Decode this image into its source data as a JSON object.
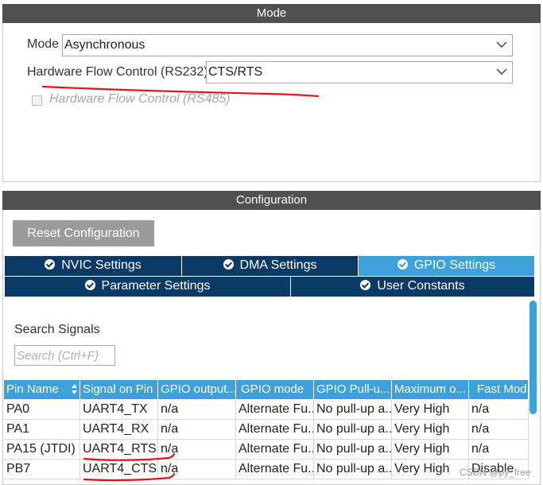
{
  "mode_section": {
    "header": "Mode",
    "mode_label": "Mode",
    "mode_value": "Asynchronous",
    "hw_flow_label": "Hardware Flow Control (RS232)",
    "hw_flow_value": "CTS/RTS",
    "rs485_label": "Hardware Flow Control (RS485)"
  },
  "config_section": {
    "header": "Configuration",
    "reset_button": "Reset Configuration",
    "tabs_row1": [
      "NVIC Settings",
      "DMA Settings",
      "GPIO Settings"
    ],
    "tabs_row2": [
      "Parameter Settings",
      "User Constants"
    ],
    "active_tab": "GPIO Settings",
    "search_label": "Search Signals",
    "search_placeholder": "Search (Ctrl+F)"
  },
  "table": {
    "columns": [
      "Pin Name",
      "Signal on Pin",
      "GPIO output...",
      "GPIO mode",
      "GPIO Pull-u...",
      "Maximum o...",
      "Fast Mod"
    ],
    "rows": [
      [
        "PA0",
        "UART4_TX",
        "n/a",
        "Alternate Fu...",
        "No pull-up a...",
        "Very High",
        "n/a"
      ],
      [
        "PA1",
        "UART4_RX",
        "n/a",
        "Alternate Fu...",
        "No pull-up a...",
        "Very High",
        "n/a"
      ],
      [
        "PA15 (JTDI)",
        "UART4_RTS",
        "n/a",
        "Alternate Fu...",
        "No pull-up a...",
        "Very High",
        "n/a"
      ],
      [
        "PB7",
        "UART4_CTS",
        "n/a",
        "Alternate Fu...",
        "No pull-up a...",
        "Very High",
        "Disable"
      ]
    ]
  },
  "watermark": "CSDN @py_free",
  "colors": {
    "section_header_bg": "#505050",
    "tab_bg": "#0b3a66",
    "tab_active_bg": "#3ea1db",
    "table_header_bg": "#3ea1db",
    "annotation_red": "#e8141a",
    "scrollbar": "#3ea1db"
  }
}
